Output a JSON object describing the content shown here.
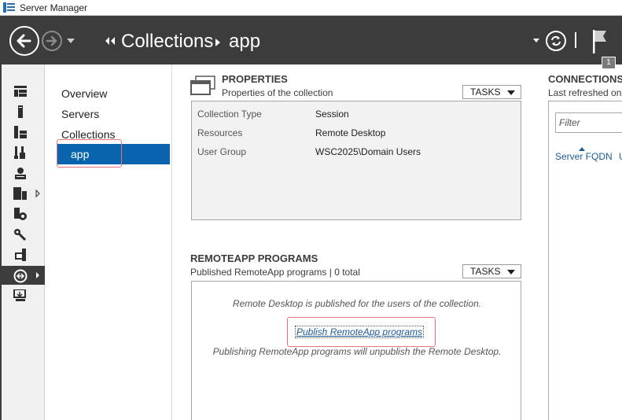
{
  "window": {
    "title": "Server Manager"
  },
  "header": {
    "breadcrumb": [
      "Collections",
      "app"
    ],
    "notification_count": "1"
  },
  "rail": {
    "items": [
      "dashboard-icon",
      "local-server-icon",
      "all-servers-icon",
      "file-services-icon",
      "iis-icon",
      "remote-desktop-icon",
      "print-services-icon",
      "tools-icon",
      "wsus-icon",
      "remote-access-icon",
      "backup-icon"
    ],
    "active_index": 9
  },
  "nav": {
    "items": [
      "Overview",
      "Servers",
      "Collections"
    ],
    "active": "app"
  },
  "properties": {
    "title": "PROPERTIES",
    "subtitle": "Properties of the collection",
    "tasks_label": "TASKS",
    "rows": [
      {
        "label": "Collection Type",
        "value": "Session"
      },
      {
        "label": "Resources",
        "value": "Remote Desktop"
      },
      {
        "label": "User Group",
        "value": "WSC2025\\Domain Users"
      }
    ]
  },
  "remoteapp": {
    "title": "REMOTEAPP PROGRAMS",
    "subtitle": "Published RemoteApp programs | 0 total",
    "tasks_label": "TASKS",
    "message": "Remote Desktop is published for the users of the collection.",
    "link": "Publish RemoteApp programs",
    "note": "Publishing RemoteApp programs will unpublish the Remote Desktop."
  },
  "connections": {
    "title": "CONNECTIONS",
    "subtitle": "Last refreshed on",
    "filter_placeholder": "Filter",
    "columns": [
      "Server FQDN",
      "U"
    ]
  },
  "colors": {
    "header_bg": "#3c3c3c",
    "accent": "#0a64ad",
    "highlight": "#e8747c",
    "link": "#1c5a96"
  }
}
